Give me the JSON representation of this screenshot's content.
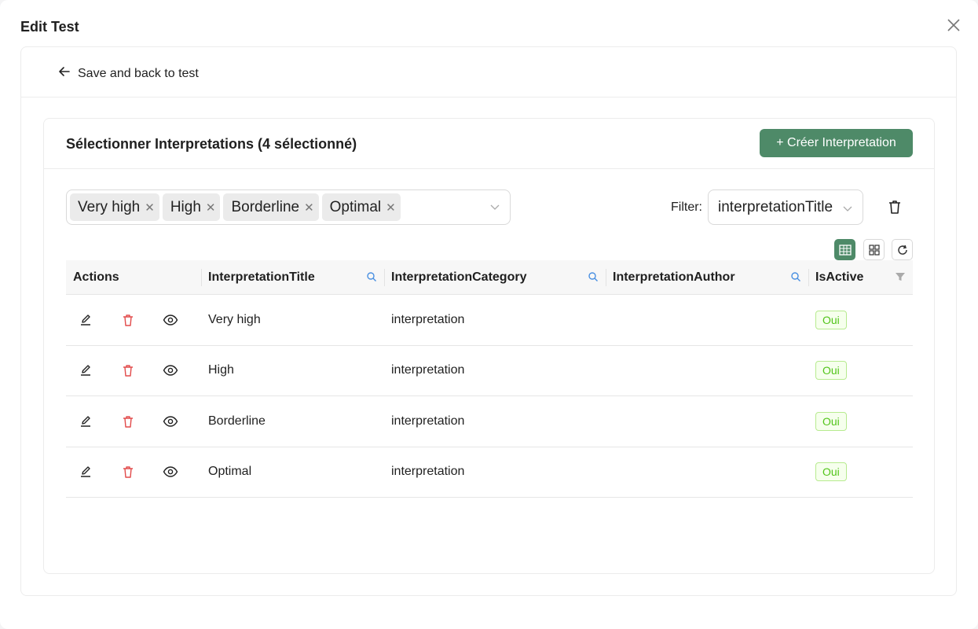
{
  "modal": {
    "title": "Edit Test"
  },
  "back": {
    "label": "Save and back to test"
  },
  "section": {
    "title": "Sélectionner Interpretations (4 sélectionné)",
    "create_label": "+ Créer Interpretation"
  },
  "tags": [
    "Very high",
    "High",
    "Borderline",
    "Optimal"
  ],
  "filter": {
    "label": "Filter:",
    "value": "interpretationTitle"
  },
  "columns": [
    "Actions",
    "InterpretationTitle",
    "InterpretationCategory",
    "InterpretationAuthor",
    "IsActive"
  ],
  "rows": [
    {
      "title": "Very high",
      "category": "interpretation",
      "author": "",
      "active": "Oui"
    },
    {
      "title": "High",
      "category": "interpretation",
      "author": "",
      "active": "Oui"
    },
    {
      "title": "Borderline",
      "category": "interpretation",
      "author": "",
      "active": "Oui"
    },
    {
      "title": "Optimal",
      "category": "interpretation",
      "author": "",
      "active": "Oui"
    }
  ],
  "colors": {
    "primary": "#4e8a68",
    "danger": "#e24b4b",
    "success": "#52c41a",
    "search_icon": "#4a90e2"
  },
  "icons": {
    "close": "close-icon",
    "back": "arrow-left-icon",
    "trash": "trash-icon",
    "edit": "edit-icon",
    "view": "eye-icon",
    "grid": "table-view-icon",
    "cards": "card-view-icon",
    "refresh": "refresh-icon",
    "search": "search-icon",
    "filter": "filter-icon"
  }
}
